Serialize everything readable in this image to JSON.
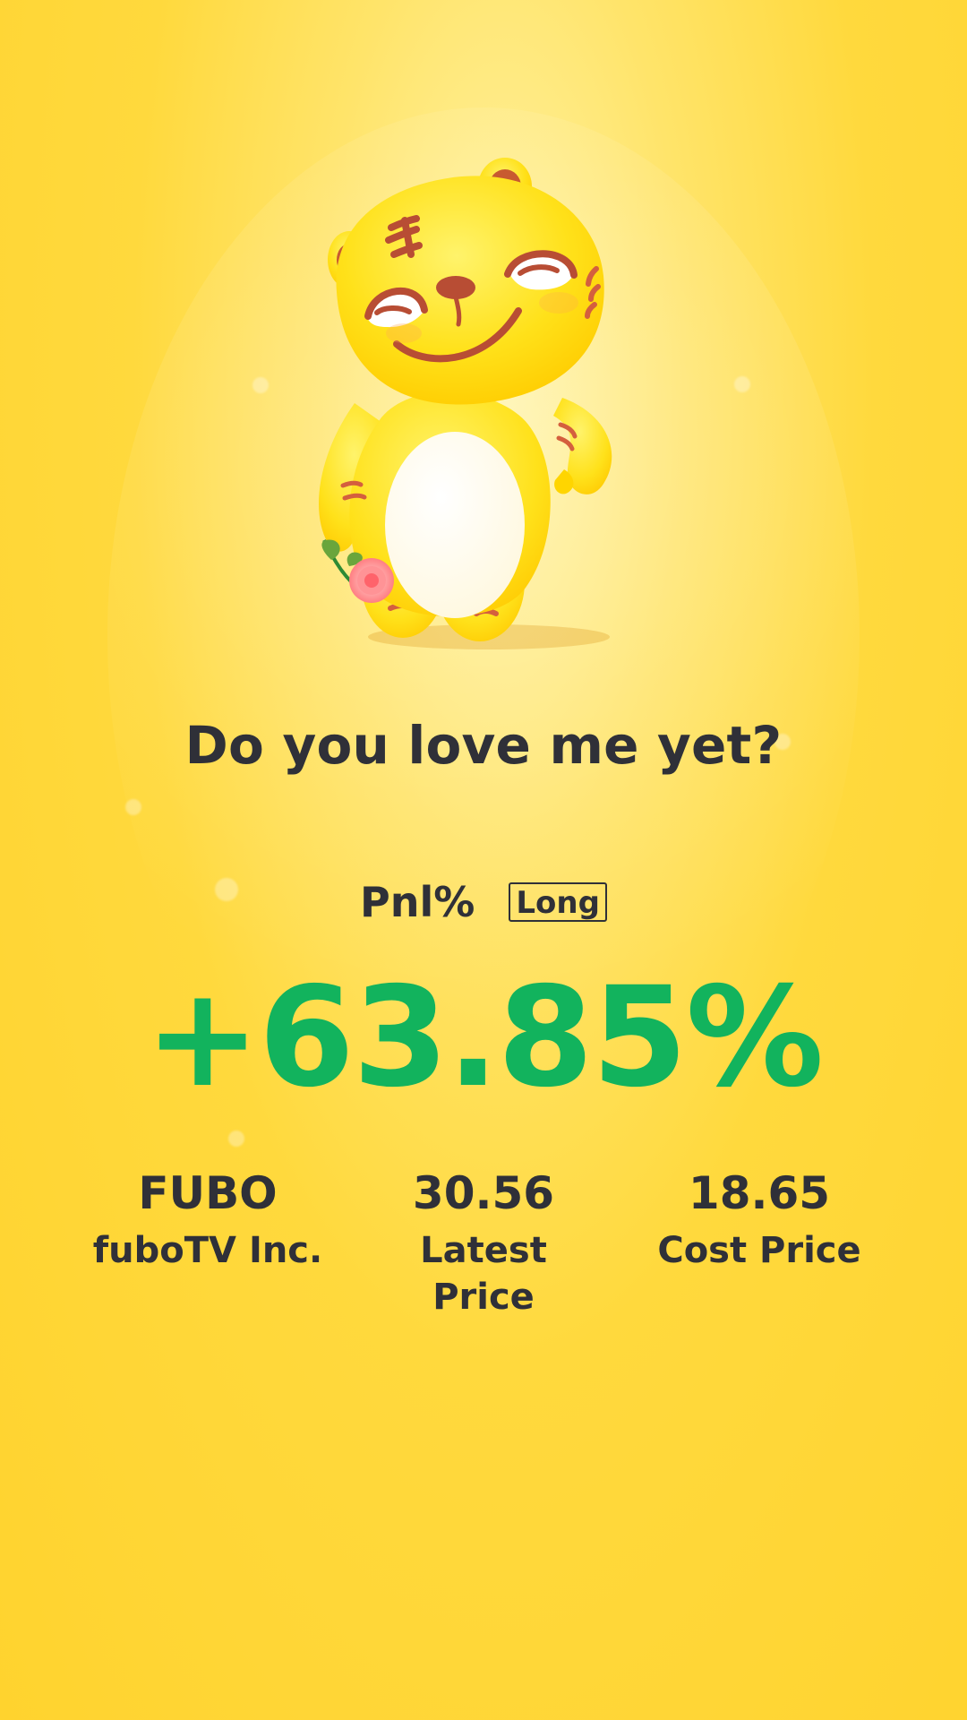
{
  "colors": {
    "background": "#ffd93d",
    "text": "#2f3038",
    "positive": "#12b35d"
  },
  "mascot": {
    "name": "tiger-mascot-icon"
  },
  "headline": "Do you love me yet?",
  "pnl": {
    "label": "Pnl%",
    "position_type": "Long",
    "value": "+63.85%"
  },
  "stats": [
    {
      "value": "FUBO",
      "label": "fuboTV Inc."
    },
    {
      "value": "30.56",
      "label": "Latest Price"
    },
    {
      "value": "18.65",
      "label": "Cost Price"
    }
  ]
}
